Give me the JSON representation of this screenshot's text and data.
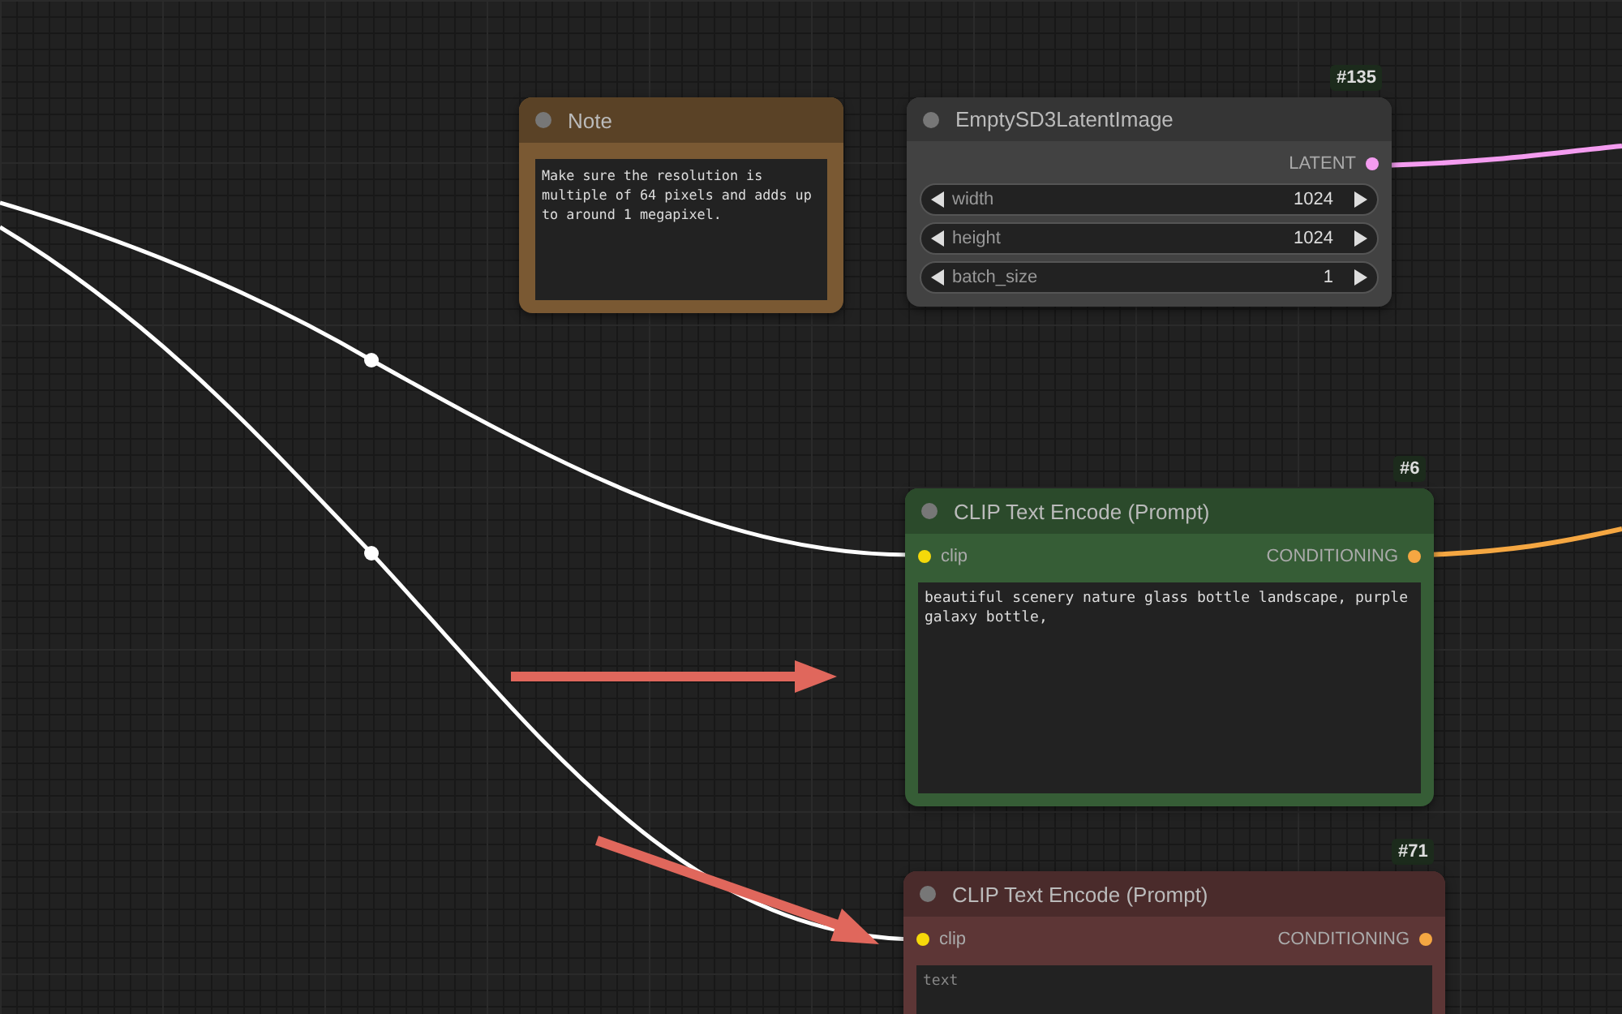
{
  "nodes": [
    {
      "kind": "note",
      "title": "Note",
      "color": "#5a4226",
      "text": "Make sure the resolution is multiple of 64 pixels and adds up to around 1 megapixel."
    },
    {
      "kind": "latent",
      "badge": "#135",
      "title": "EmptySD3LatentImage",
      "color": "#353535",
      "outputs": [
        {
          "label": "LATENT",
          "color": "#f49cf0"
        }
      ],
      "widgets": [
        {
          "label": "width",
          "value": "1024"
        },
        {
          "label": "height",
          "value": "1024"
        },
        {
          "label": "batch_size",
          "value": "1"
        }
      ]
    },
    {
      "kind": "prompt",
      "badge": "#6",
      "title": "CLIP Text Encode (Prompt)",
      "color": "#2b4a2b",
      "inputs": [
        {
          "label": "clip",
          "color": "#f5d90a"
        }
      ],
      "outputs": [
        {
          "label": "CONDITIONING",
          "color": "#f5a742"
        }
      ],
      "text": "beautiful scenery nature glass bottle landscape, purple galaxy bottle,"
    },
    {
      "kind": "prompt",
      "badge": "#71",
      "title": "CLIP Text Encode (Prompt)",
      "color": "#4a2b2b",
      "inputs": [
        {
          "label": "clip",
          "color": "#f5d90a"
        }
      ],
      "outputs": [
        {
          "label": "CONDITIONING",
          "color": "#f5a742"
        }
      ],
      "placeholder": "text"
    }
  ]
}
